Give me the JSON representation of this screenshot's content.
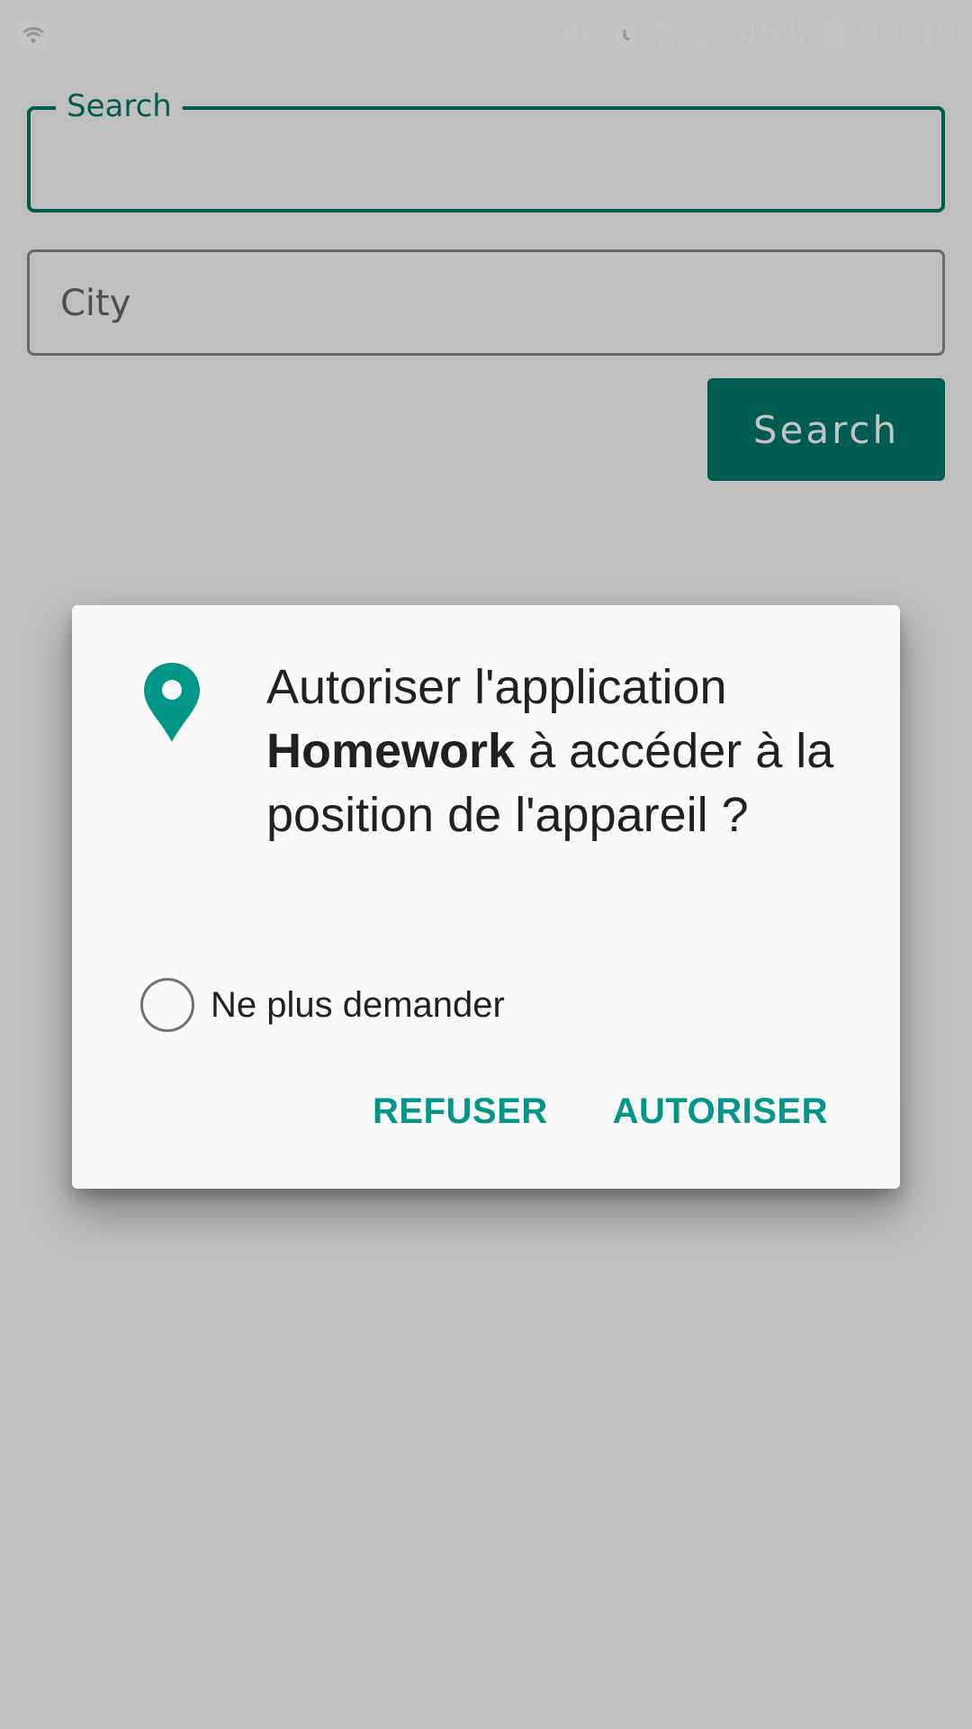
{
  "status_bar": {
    "battery": "45%",
    "time": "00:08",
    "network_type": "4G",
    "icons": [
      "wifi-icon",
      "mute-vibrate-icon",
      "alarm-icon",
      "network-4g-icon",
      "signal-icon",
      "battery-icon"
    ]
  },
  "app": {
    "search_field": {
      "label": "Search",
      "value": ""
    },
    "city_field": {
      "placeholder": "City",
      "value": ""
    },
    "search_button": {
      "label": "Search"
    }
  },
  "permission_dialog": {
    "icon": "location-pin-icon",
    "message": {
      "part1": "Autoriser l'application",
      "app_name": "Homework",
      "part2": "à accéder à la position de l'appareil ?"
    },
    "dont_ask_again": {
      "label": "Ne plus demander",
      "checked": false
    },
    "buttons": {
      "deny": "REFUSER",
      "allow": "AUTORISER"
    }
  },
  "colors": {
    "accent": "#00796b",
    "dialog_button": "#009688",
    "icon": "#009688",
    "scrim": "rgba(0,0,0,0.235)"
  }
}
